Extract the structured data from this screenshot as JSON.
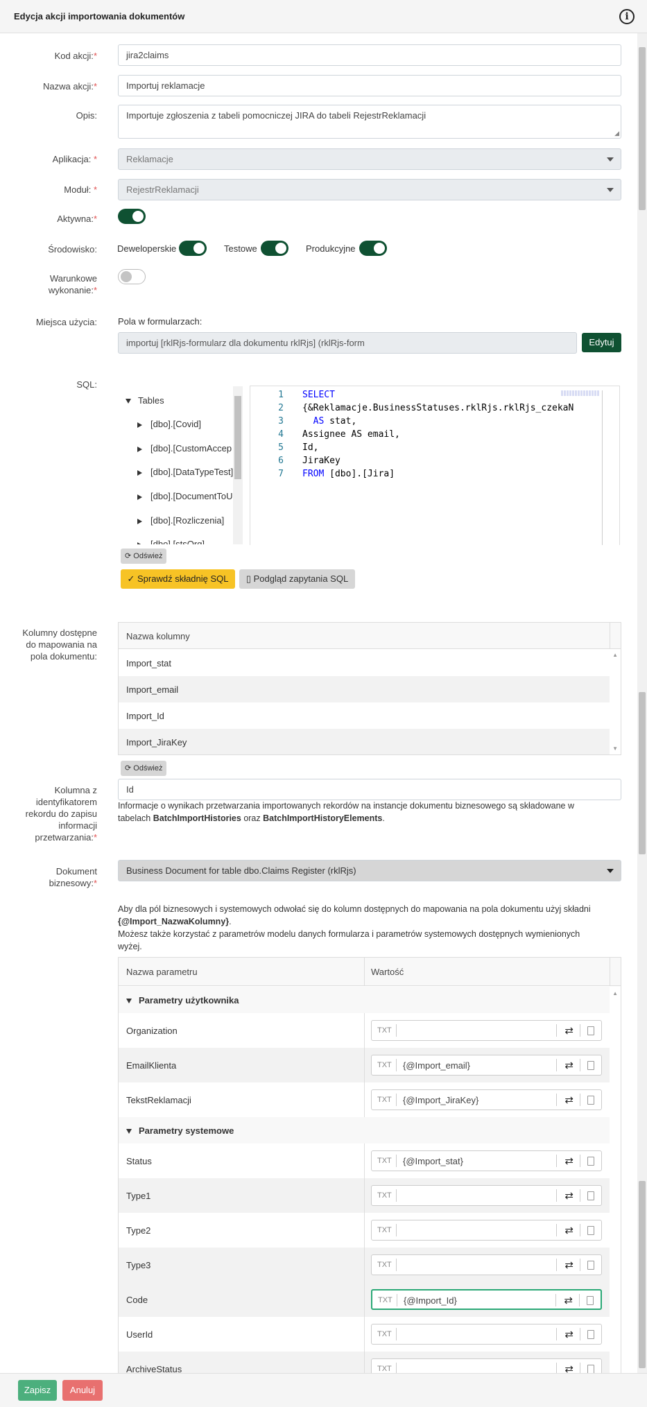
{
  "header": {
    "title": "Edycja akcji importowania dokumentów",
    "info_icon": "info-icon"
  },
  "fields": {
    "kod_label": "Kod akcji:",
    "kod_value": "jira2claims",
    "nazwa_label": "Nazwa akcji:",
    "nazwa_value": "Importuj reklamacje",
    "opis_label": "Opis:",
    "opis_value": "Importuje zgłoszenia z tabeli pomocniczej JIRA do tabeli RejestrReklamacji",
    "aplikacja_label": "Aplikacja:",
    "aplikacja_value": "Reklamacje",
    "modul_label": "Moduł:",
    "modul_value": "RejestrReklamacji",
    "aktywna_label": "Aktywna:",
    "srodowisko_label": "Środowisko:",
    "srodowisko_dev": "Deweloperskie",
    "srodowisko_test": "Testowe",
    "srodowisko_prod": "Produkcyjne",
    "warunkowe_label_1": "Warunkowe",
    "warunkowe_label_2": "wykonanie:",
    "miejsca_label": "Miejsca użycia:",
    "pola_label": "Pola w formularzach:",
    "pola_value": "importuj [rklRjs-formularz dla dokumentu rklRjs] (rklRjs-form",
    "edytuj_button": "Edytuj",
    "sql_label": "SQL:"
  },
  "tree": {
    "root": "Tables",
    "items": [
      "[dbo].[Covid]",
      "[dbo].[CustomAccep",
      "[dbo].[DataTypeTest]",
      "[dbo].[DocumentToU",
      "[dbo].[Rozliczenia]",
      "[dbo].[stsOrg]"
    ],
    "refresh": "Odśwież"
  },
  "sql": {
    "lines": [
      {
        "n": "1",
        "kw": "SELECT",
        "t": ""
      },
      {
        "n": "2",
        "kw": "",
        "t": "{&Reklamacje.BusinessStatuses.rklRjs.rklRjs_czekaN"
      },
      {
        "n": "3",
        "kw": "  AS",
        "t": " stat,"
      },
      {
        "n": "4",
        "kw": "",
        "t": "Assignee AS email,"
      },
      {
        "n": "5",
        "kw": "",
        "t": "Id,"
      },
      {
        "n": "6",
        "kw": "",
        "t": "JiraKey"
      },
      {
        "n": "7",
        "kw": "FROM",
        "t": " [dbo].[Jira]"
      }
    ],
    "check_button": "Sprawdź składnię SQL",
    "preview_button": "Podgląd zapytania SQL"
  },
  "columns": {
    "label_1": "Kolumny dostępne",
    "label_2": "do mapowania na",
    "label_3": "pola dokumentu:",
    "header": "Nazwa kolumny",
    "rows": [
      "Import_stat",
      "Import_email",
      "Import_Id",
      "Import_JiraKey"
    ],
    "refresh": "Odśwież"
  },
  "ident": {
    "label_1": "Kolumna z",
    "label_2": "identyfikatorem",
    "label_3": "rekordu do zapisu",
    "label_4": "informacji",
    "label_5": "przetwarzania:",
    "value": "Id",
    "info_1": "Informacje o wynikach przetwarzania importowanych rekordów na instancje dokumentu biznesowego są składowane w",
    "info_2a": "tabelach ",
    "info_2b": "BatchImportHistories",
    "info_2c": " oraz ",
    "info_2d": "BatchImportHistoryElements",
    "info_2e": "."
  },
  "document": {
    "label_1": "Dokument",
    "label_2": "biznesowy:",
    "value": "Business Document for table dbo.Claims Register (rklRjs)",
    "help_1": "Aby dla pól biznesowych i systemowych odwołać się do kolumn dostępnych do mapowania na pola dokumentu użyj składni",
    "help_2": "{@Import_NazwaKolumny}",
    "help_3": "Możesz także korzystać z parametrów modelu danych formularza i parametrów systemowych dostępnych wymienionych",
    "help_4": "wyżej."
  },
  "params": {
    "col_name": "Nazwa parametru",
    "col_value": "Wartość",
    "group_user": "Parametry użytkownika",
    "group_system": "Parametry systemowe",
    "txt": "TXT",
    "user": [
      {
        "name": "Organization",
        "value": ""
      },
      {
        "name": "EmailKlienta",
        "value": "{@Import_email}"
      },
      {
        "name": "TekstReklamacji",
        "value": "{@Import_JiraKey}"
      }
    ],
    "system": [
      {
        "name": "Status",
        "value": "{@Import_stat}"
      },
      {
        "name": "Type1",
        "value": ""
      },
      {
        "name": "Type2",
        "value": ""
      },
      {
        "name": "Type3",
        "value": ""
      },
      {
        "name": "Code",
        "value": "{@Import_Id}"
      },
      {
        "name": "UserId",
        "value": ""
      },
      {
        "name": "ArchiveStatus",
        "value": ""
      }
    ]
  },
  "footer": {
    "save": "Zapisz",
    "cancel": "Anuluj"
  },
  "colors": {
    "accent": "#0f5132",
    "warning": "#f7c325",
    "save": "#4caf7d",
    "cancel": "#e8706f"
  }
}
